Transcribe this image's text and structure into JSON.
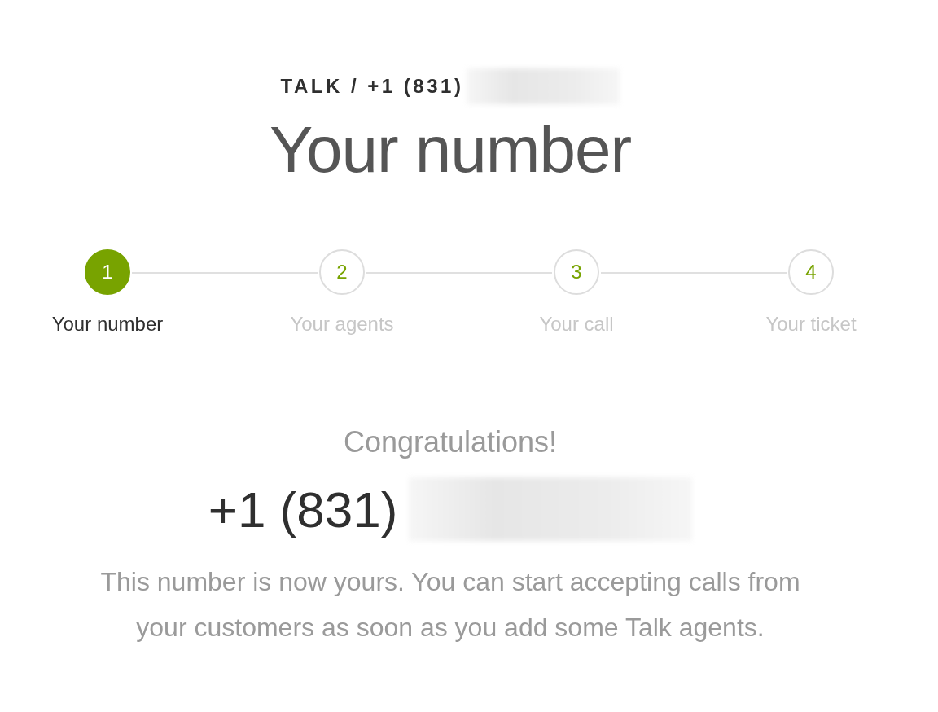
{
  "breadcrumb": {
    "text": "TALK / +1 (831)",
    "redacted_tail": true
  },
  "title": "Your number",
  "steps": [
    {
      "number": "1",
      "label": "Your number",
      "selected": true
    },
    {
      "number": "2",
      "label": "Your agents",
      "selected": false
    },
    {
      "number": "3",
      "label": "Your call",
      "selected": false
    },
    {
      "number": "4",
      "label": "Your ticket",
      "selected": false
    }
  ],
  "result": {
    "heading": "Congratulations!",
    "phone": "+1 (831)",
    "redacted_tail": true,
    "message": "This number is now yours. You can start accepting calls from your customers as soon as you add some Talk agents."
  }
}
